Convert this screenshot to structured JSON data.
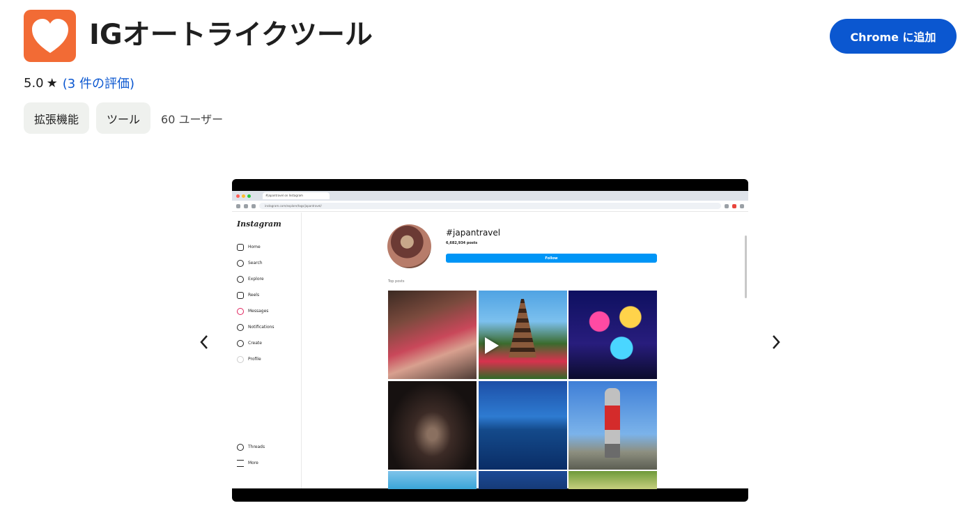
{
  "header": {
    "title": "IGオートライクツール",
    "add_button_label": "Chrome に追加"
  },
  "rating": {
    "score": "5.0",
    "star": "★",
    "count_text": "(3 件の評価)"
  },
  "chips": [
    "拡張機能",
    "ツール"
  ],
  "users_text": "60 ユーザー",
  "carousel": {
    "prev_arrow": "‹",
    "next_arrow": "›",
    "screenshot": {
      "tab_title": "#japantravel on Instagram",
      "url": "instagram.com/explore/tags/japantravel/",
      "ig_logo": "Instagram",
      "nav_items": [
        "Home",
        "Search",
        "Explore",
        "Reels",
        "Messages",
        "Notifications",
        "Create",
        "Profile"
      ],
      "bottom_items": [
        "Threads",
        "More"
      ],
      "hashtag": "#japantravel",
      "posts_count": "6,682,934 posts",
      "follow_label": "Follow",
      "section_label": "Top posts"
    }
  },
  "colors": {
    "icon_bg": "#f26b35",
    "button_bg": "#0b57d0",
    "link": "#0b57d0",
    "chip_bg": "#eff1ee",
    "follow_bg": "#0095f6"
  },
  "icons": {
    "app_icon": "heart-icon",
    "prev": "chevron-left-icon",
    "next": "chevron-right-icon",
    "play": "play-icon"
  }
}
